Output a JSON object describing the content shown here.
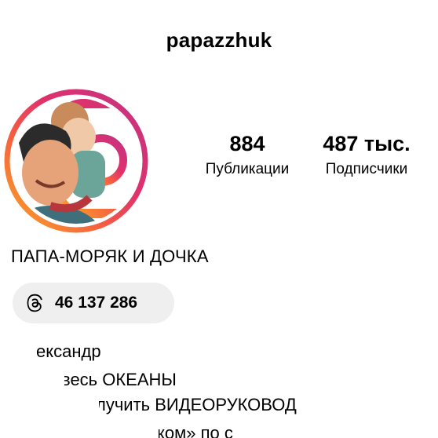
{
  "profile": {
    "username": "papazzhuk",
    "display_name": "ПАПА-МОРЯК И ДОЧКА"
  },
  "stats": {
    "posts": {
      "value": "884",
      "label": "Публикации"
    },
    "followers": {
      "value": "487 тыс.",
      "label": "Подписчики"
    }
  },
  "threads": {
    "icon": "threads-icon",
    "count": "46 137 286"
  },
  "bio": {
    "lines": [
      "ександр",
      "весь ОКЕАНЫ",
      "лучить ВИДЕОРУКОВОД",
      "ком» по с"
    ]
  },
  "colors": {
    "ring_start": "#f9a825",
    "ring_mid": "#e1306c",
    "ring_end": "#c13584",
    "pill_bg": "#efefef"
  }
}
